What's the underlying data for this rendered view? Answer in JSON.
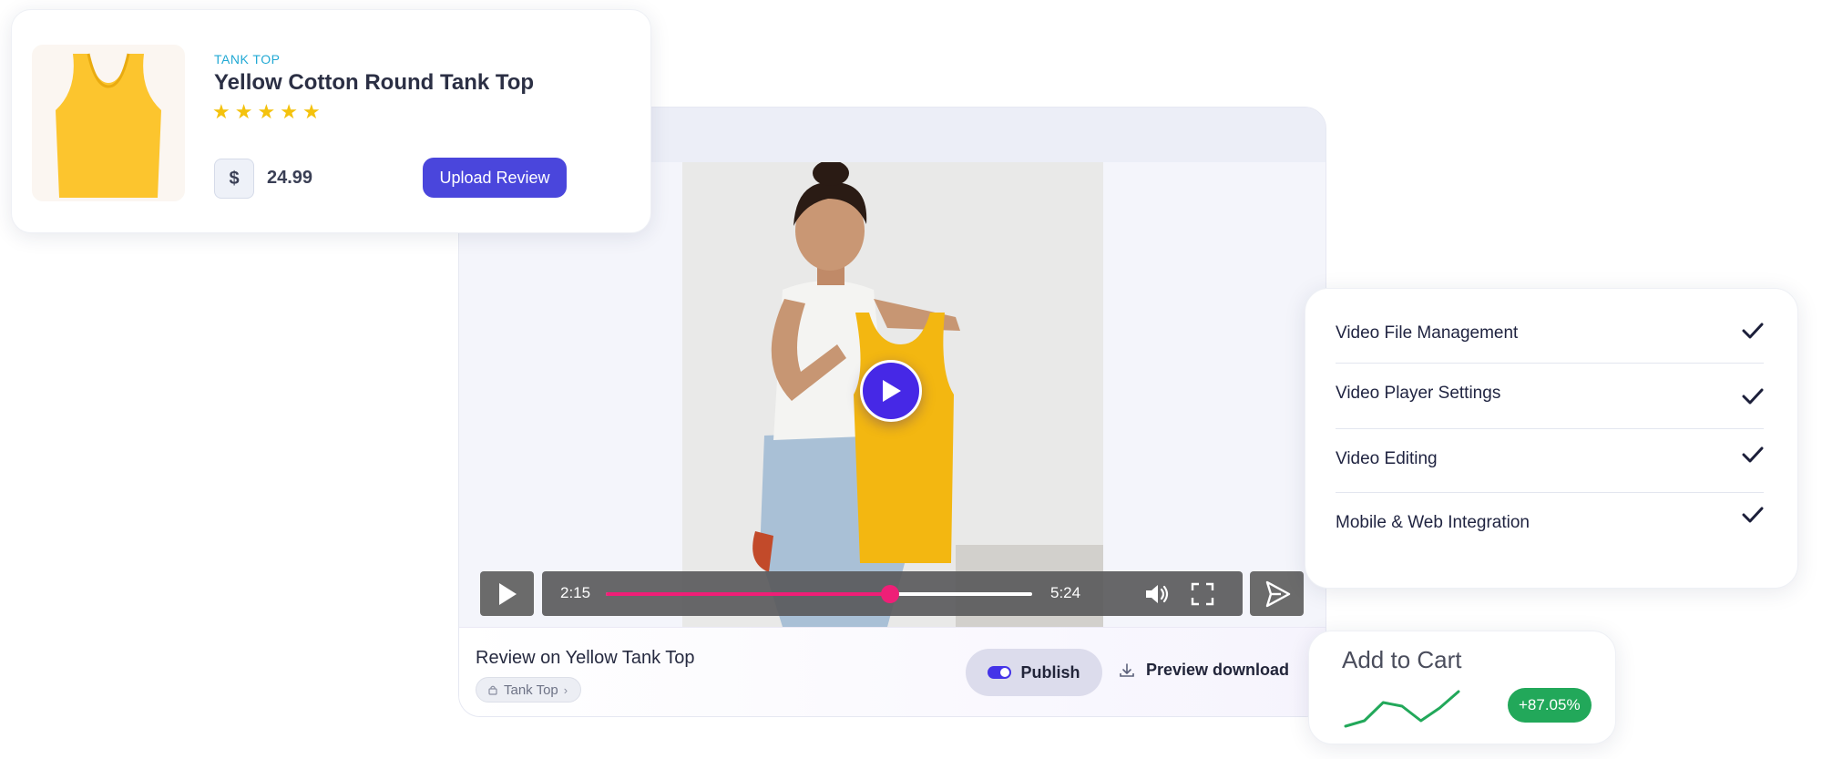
{
  "product": {
    "category": "TANK TOP",
    "name": "Yellow Cotton Round Tank Top",
    "rating": 5,
    "stars": [
      "★",
      "★",
      "★",
      "★",
      "★"
    ],
    "currency_symbol": "$",
    "price": "24.99",
    "upload_label": "Upload  Review",
    "image_icon": "tank-top-icon"
  },
  "player": {
    "current_time": "2:15",
    "duration": "5:24",
    "progress": 0.666,
    "play_icon": "play-icon",
    "volume_icon": "volume-icon",
    "fullscreen_icon": "fullscreen-icon",
    "send_icon": "send-icon"
  },
  "video_footer": {
    "title": "Review on Yellow Tank Top",
    "tag": "Tank Top",
    "publish_label": "Publish",
    "publish_on": true,
    "download_label": "Preview download"
  },
  "features": [
    {
      "label": "Video File Management",
      "checked": true
    },
    {
      "label": "Video Player Settings",
      "checked": true
    },
    {
      "label": "Video Editing",
      "checked": true
    },
    {
      "label": "Mobile & Web Integration",
      "checked": true
    }
  ],
  "cart": {
    "title": "Add to Cart",
    "change": "+87.05%",
    "trend": [
      0.05,
      0.2,
      0.7,
      0.6,
      0.2,
      0.55,
      1.0
    ]
  },
  "colors": {
    "accent": "#4a46dc",
    "play": "#4628e6",
    "progress": "#ef1f77",
    "positive": "#22a85a",
    "star": "#f4c20d",
    "category": "#22a9d4"
  }
}
